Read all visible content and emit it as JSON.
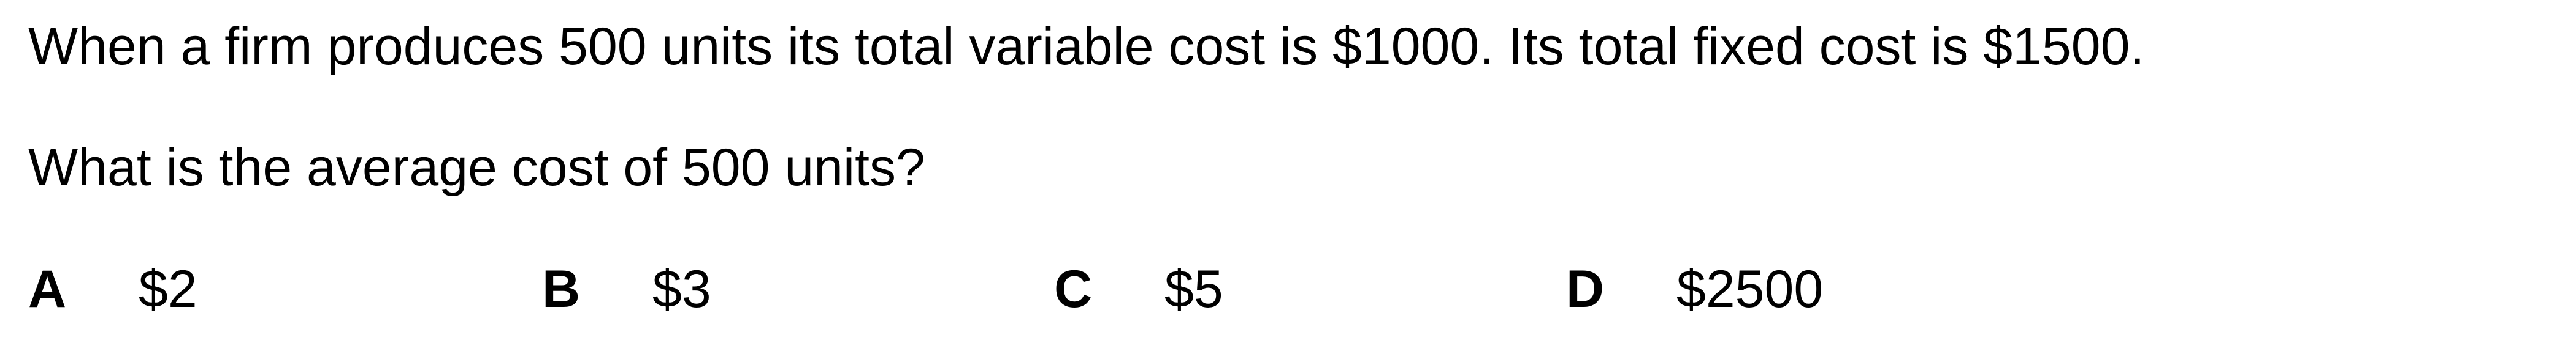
{
  "question": {
    "stem": "When a firm produces 500 units its total variable cost is $1000. Its total fixed cost is $1500.",
    "prompt": "What is the average cost of 500 units?"
  },
  "options": [
    {
      "letter": "A",
      "value": "$2"
    },
    {
      "letter": "B",
      "value": "$3"
    },
    {
      "letter": "C",
      "value": "$5"
    },
    {
      "letter": "D",
      "value": "$2500"
    }
  ]
}
